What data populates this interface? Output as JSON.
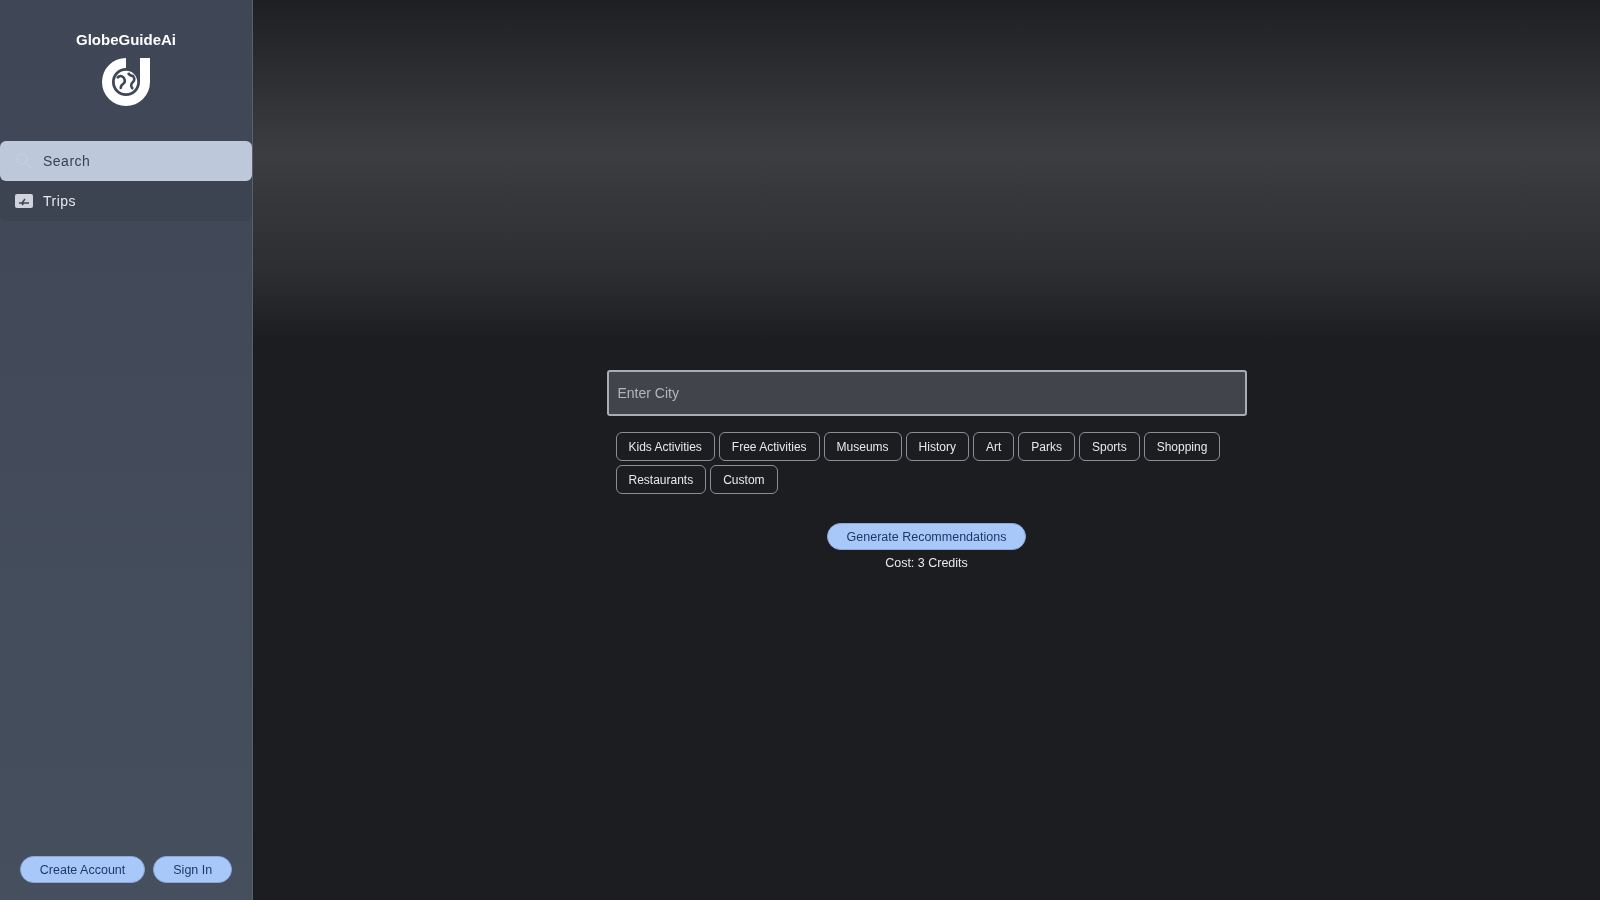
{
  "sidebar": {
    "brand": "GlobeGuideAi",
    "nav": [
      {
        "label": "Search",
        "kind": "search",
        "selected": true
      },
      {
        "label": "Trips",
        "kind": "trips",
        "selected": false
      }
    ],
    "buttons": [
      "Create Account",
      "Sign In"
    ]
  },
  "search": {
    "placeholder": "Enter City"
  },
  "categories": [
    "Kids Activities",
    "Free Activities",
    "Museums",
    "History",
    "Art",
    "Parks",
    "Sports",
    "Shopping",
    "Restaurants",
    "Custom"
  ],
  "generate": {
    "label": "Generate Recommendations",
    "cost": "Cost: 3 Credits"
  }
}
